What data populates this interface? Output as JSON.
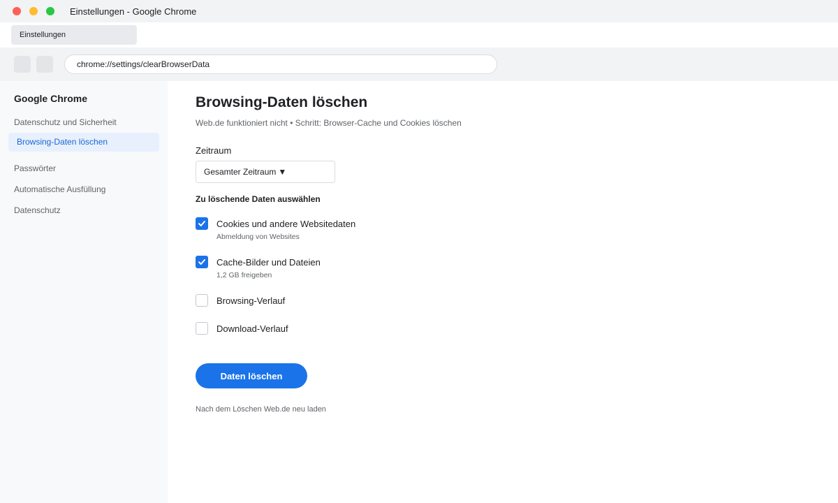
{
  "window": {
    "title": "Einstellungen - Google Chrome"
  },
  "tab": {
    "label": "Einstellungen"
  },
  "omnibox": {
    "url": "chrome://settings/clearBrowserData"
  },
  "sidebar": {
    "title": "Google Chrome",
    "items": [
      {
        "label": "Datenschutz und Sicherheit",
        "active": false
      },
      {
        "label": "Browsing-Daten löschen",
        "active": true
      },
      {
        "label": "Passwörter",
        "active": false
      },
      {
        "label": "Automatische Ausfüllung",
        "active": false
      },
      {
        "label": "Datenschutz",
        "active": false
      }
    ]
  },
  "main": {
    "title": "Browsing-Daten löschen",
    "subtitle": "Web.de funktioniert nicht • Schritt: Browser-Cache und Cookies löschen",
    "time_range": {
      "label": "Zeitraum",
      "selected": "Gesamter Zeitraum",
      "caret": "▼"
    },
    "section_heading": "Zu löschende Daten auswählen",
    "options": [
      {
        "label": "Cookies und andere Websitedaten",
        "sublabel": "Abmeldung von Websites",
        "checked": true
      },
      {
        "label": "Cache-Bilder und Dateien",
        "sublabel": "1,2 GB freigeben",
        "checked": true
      },
      {
        "label": "Browsing-Verlauf",
        "sublabel": "",
        "checked": false
      },
      {
        "label": "Download-Verlauf",
        "sublabel": "",
        "checked": false
      }
    ],
    "clear_button": "Daten löschen",
    "footnote": "Nach dem Löschen Web.de neu laden"
  },
  "colors": {
    "accent": "#1a73e8",
    "active_nav_bg": "#e8f0fe",
    "active_nav_text": "#1967d2"
  },
  "icons": {
    "checkbox_checked": "checkmark-icon",
    "dropdown": "caret-down-icon"
  }
}
